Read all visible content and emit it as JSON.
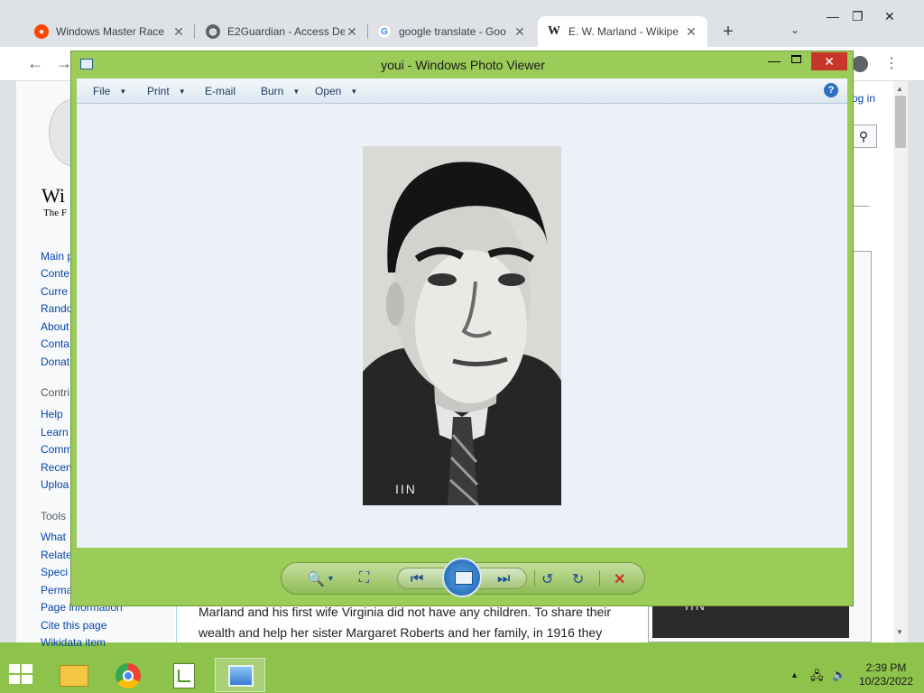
{
  "browser": {
    "tabs": [
      {
        "title": "Windows Master Race",
        "icon": "reddit-icon",
        "color": "#ff4500"
      },
      {
        "title": "E2Guardian - Access De",
        "icon": "globe-icon",
        "color": "#5f6368"
      },
      {
        "title": "google translate - Goo",
        "icon": "google-icon",
        "color": "#4285f4"
      },
      {
        "title": "E. W. Marland - Wikipe",
        "icon": "wikipedia-icon",
        "color": "#202124",
        "glyph": "W"
      }
    ],
    "new_tab": "+",
    "tab_menu": "⌄",
    "window_controls": {
      "minimize": "—",
      "maximize": "❐",
      "close": "✕"
    },
    "toolbar": {
      "back": "←",
      "forward": "→",
      "menu": "⋮"
    }
  },
  "wiki": {
    "logo_word": "Wi",
    "logo_tagline": "The F",
    "login": "og in",
    "search_button": "⚲",
    "nav_main": [
      "Main p",
      "Conte",
      "Curre",
      "Rando",
      "About",
      "Conta",
      "Donat"
    ],
    "nav_contribute_head": "Contri",
    "nav_contribute": [
      "Help",
      "Learn",
      "Comm",
      "Recen",
      "Uploa"
    ],
    "nav_tools_head": "Tools",
    "nav_tools": [
      "What",
      "Relate",
      "Speci",
      "Perma",
      "Page information",
      "Cite this page",
      "Wikidata item"
    ],
    "paragraph_line1": "Marland and his first wife Virginia did not have any children. To share their",
    "paragraph_line2": "wealth and help her sister Margaret Roberts and her family, in 1916 they",
    "infobox_caption": "IIN"
  },
  "photo_viewer": {
    "title": "youi - Windows Photo Viewer",
    "menu": [
      {
        "label": "File",
        "dropdown": true
      },
      {
        "label": "Print",
        "dropdown": true
      },
      {
        "label": "E-mail",
        "dropdown": false
      },
      {
        "label": "Burn",
        "dropdown": true
      },
      {
        "label": "Open",
        "dropdown": true
      }
    ],
    "help": "?",
    "photo_caption": "IIN",
    "controls": {
      "zoom": "🔍",
      "fit": "⛶",
      "previous": "⏮",
      "next": "⏭",
      "rotate_ccw": "↺",
      "rotate_cw": "↻",
      "delete": "✕"
    },
    "window_controls": {
      "minimize": "—",
      "close": "✕"
    }
  },
  "taskbar": {
    "apps": [
      {
        "name": "file-explorer-icon",
        "color": "#f3c743"
      },
      {
        "name": "chrome-icon",
        "color": "#4285f4"
      },
      {
        "name": "notepad-plus-plus-icon",
        "color": "#8bc34a"
      },
      {
        "name": "photo-viewer-icon",
        "color": "#3a7bd5",
        "active": true
      }
    ],
    "tray": {
      "chevron": "▲",
      "network": "🖧",
      "volume": "🔈"
    },
    "clock_time": "2:39 PM",
    "clock_date": "10/23/2022"
  }
}
